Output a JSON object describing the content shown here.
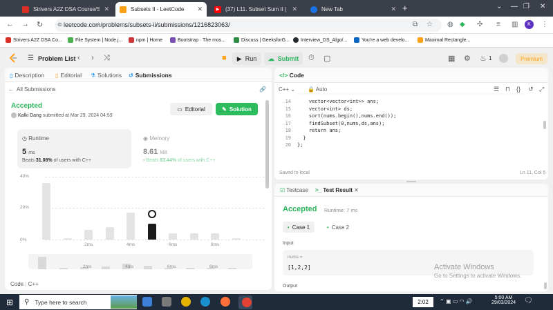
{
  "browser": {
    "tabs": [
      {
        "title": "Strivers A2Z DSA Course/Sheet",
        "active": false,
        "favicon_color": "#d93025"
      },
      {
        "title": "Subsets II - LeetCode",
        "active": true,
        "favicon_color": "#ffa116"
      },
      {
        "title": "(37) L11. Subset Sum II | Leetco",
        "active": false,
        "favicon_color": "#ff0000"
      },
      {
        "title": "New Tab",
        "active": false,
        "favicon_color": "#1a73e8"
      }
    ],
    "url": "leetcode.com/problems/subsets-ii/submissions/1216823063/",
    "bookmarks": [
      {
        "label": "Strivers A2Z DSA Co...",
        "color": "#d93025"
      },
      {
        "label": "File System | Node.j...",
        "color": "#4caf50"
      },
      {
        "label": "npm | Home",
        "color": "#cb3837"
      },
      {
        "label": "Bootstrap · The mos...",
        "color": "#7952b3"
      },
      {
        "label": "Discuss | GeeksforG...",
        "color": "#2f8d46"
      },
      {
        "label": "Interview_DS_Algo/...",
        "color": "#24292f"
      },
      {
        "label": "You're a web develo...",
        "color": "#0a66c2"
      },
      {
        "label": "Maximal Rectangle...",
        "color": "#ffa116"
      }
    ],
    "profile_initial": "K"
  },
  "lc_header": {
    "problem_list": "Problem List",
    "run": "Run",
    "submit": "Submit",
    "streak": "1",
    "premium": "Premium"
  },
  "left_tabs": [
    "Description",
    "Editorial",
    "Solutions",
    "Submissions"
  ],
  "submission": {
    "back": "All Submissions",
    "status": "Accepted",
    "user": "Kalki Dang",
    "submitted": "submitted at Mar 29, 2024 04:59",
    "editorial_btn": "Editorial",
    "solution_btn": "Solution",
    "runtime": {
      "title": "Runtime",
      "value": "5",
      "unit": "ms",
      "beats_prefix": "Beats",
      "beats": "31.08%",
      "beats_suffix": "of users with C++"
    },
    "memory": {
      "title": "Memory",
      "value": "8.61",
      "unit": "MB",
      "beats_prefix": "Beats",
      "beats": "83.44%",
      "beats_suffix": "of users with C++"
    },
    "code_label": "Code",
    "code_lang": "C++"
  },
  "chart_data": {
    "type": "bar",
    "yticks": [
      "40%",
      "20%",
      "0%"
    ],
    "ylim": [
      0,
      40
    ],
    "xticks": [
      "2ms",
      "4ms",
      "6ms",
      "8ms"
    ],
    "values": [
      36,
      1,
      6,
      8,
      17,
      10,
      4,
      4,
      4,
      1
    ],
    "highlight_index": 5
  },
  "editor": {
    "title": "Code",
    "lang": "C++",
    "mode": "Auto",
    "lines": [
      {
        "n": "14",
        "text": "    vector<vector<int>> ans;"
      },
      {
        "n": "15",
        "text": "    vector<int> ds;"
      },
      {
        "n": "16",
        "text": "    sort(nums.begin(),nums.end());"
      },
      {
        "n": "17",
        "text": "    findSubset(0,nums,ds,ans);"
      },
      {
        "n": "18",
        "text": "    return ans;"
      },
      {
        "n": "19",
        "text": "  }"
      },
      {
        "n": "20",
        "text": "};"
      }
    ],
    "saved": "Saved to local",
    "cursor": "Ln 11, Col 5"
  },
  "test": {
    "testcase_tab": "Testcase",
    "result_tab": "Test Result",
    "status": "Accepted",
    "runtime": "Runtime: 7 ms",
    "case1": "Case 1",
    "case2": "Case 2",
    "input_label": "Input",
    "param_name": "nums =",
    "param_value": "[1,2,2]",
    "output_label": "Output"
  },
  "watermark": {
    "line1": "Activate Windows",
    "line2": "Go to Settings to activate Windows."
  },
  "taskbar": {
    "search_placeholder": "Type here to search",
    "clock_badge": "2:02",
    "time": "5:00 AM",
    "date": "29/03/2024"
  }
}
